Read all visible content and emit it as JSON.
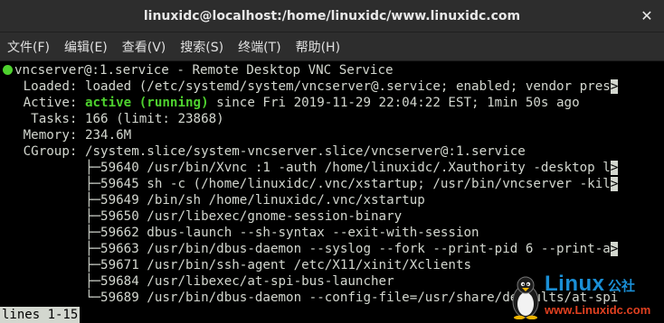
{
  "window": {
    "title": "linuxidc@localhost:/home/linuxidc/www.linuxidc.com",
    "close_glyph": "✕"
  },
  "menubar": {
    "items": [
      "文件(F)",
      "编辑(E)",
      "查看(V)",
      "搜索(S)",
      "终端(T)",
      "帮助(H)"
    ]
  },
  "terminal": {
    "service_line": "vncserver@:1.service - Remote Desktop VNC Service",
    "loaded_line": "   Loaded: loaded (/etc/systemd/system/vncserver@.service; enabled; vendor pres",
    "active_label": "   Active: ",
    "active_state": "active (running)",
    "active_rest": " since Fri 2019-11-29 22:04:22 EST; 1min 50s ago",
    "tasks_line": "    Tasks: 166 (limit: 23868)",
    "memory_line": "   Memory: 234.6M",
    "cgroup_line": "   CGroup: /system.slice/system-vncserver.slice/vncserver@:1.service",
    "process_lines": [
      "           ├─59640 /usr/bin/Xvnc :1 -auth /home/linuxidc/.Xauthority -desktop l",
      "           ├─59645 sh -c (/home/linuxidc/.vnc/xstartup; /usr/bin/vncserver -kil",
      "           ├─59649 /bin/sh /home/linuxidc/.vnc/xstartup",
      "           ├─59650 /usr/libexec/gnome-session-binary",
      "           ├─59662 dbus-launch --sh-syntax --exit-with-session",
      "           ├─59663 /usr/bin/dbus-daemon --syslog --fork --print-pid 6 --print-a",
      "           ├─59671 /usr/bin/ssh-agent /etc/X11/xinit/Xclients",
      "           ├─59684 /usr/libexec/at-spi-bus-launcher",
      "           └─59689 /usr/bin/dbus-daemon --config-file=/usr/share/defaults/at-spi"
    ],
    "truncation_marker": ">",
    "pager_status": "lines 1-15"
  },
  "watermark": {
    "brand": "Linux",
    "brand_cn": "公社",
    "url": "www.Linuxidc.com"
  },
  "colors": {
    "status_dot": "#4ed12e",
    "active_text": "#4ed12e",
    "terminal_bg": "#000000",
    "terminal_fg": "#d3d7cf",
    "titlebar_bg": "#2d2d2d"
  }
}
